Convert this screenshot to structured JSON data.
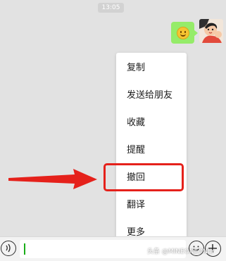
{
  "timestamp": "13:05",
  "message": {
    "emoji": "grinning-face-emoji"
  },
  "context_menu": {
    "items": [
      {
        "label": "复制"
      },
      {
        "label": "发送给朋友"
      },
      {
        "label": "收藏"
      },
      {
        "label": "提醒"
      },
      {
        "label": "撤回"
      },
      {
        "label": "翻译"
      },
      {
        "label": "更多"
      }
    ],
    "highlighted_index": 4
  },
  "input_bar": {
    "voice_icon": "voice-icon",
    "plus_icon": "plus-icon",
    "emoji_icon": "emoji-face-icon",
    "value": ""
  },
  "watermark": "头条 @MINEONEONLY",
  "colors": {
    "bubble": "#95ec69",
    "highlight": "#e5211b",
    "cursor": "#1aad19"
  }
}
